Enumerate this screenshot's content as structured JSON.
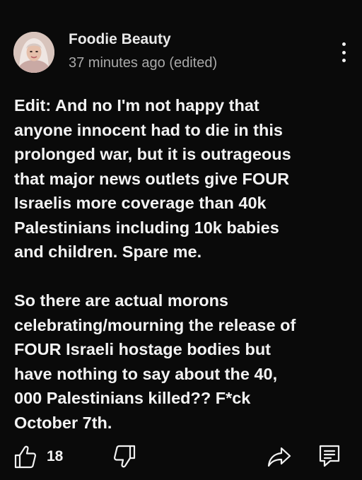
{
  "comment": {
    "author": "Foodie Beauty",
    "timestamp": "37 minutes ago (edited)",
    "paragraphs": [
      "Edit: And no I'm not happy that\nanyone innocent had to die in this\nprolonged war, but it is outrageous\nthat major news outlets give FOUR\nIsraelis more coverage than 40k\nPalestinians including 10k babies\nand children. Spare me.",
      "So there are actual morons\ncelebrating/mourning the release of\nFOUR Israeli hostage bodies but\nhave nothing to say about the 40,\n000 Palestinians killed?? F*ck\nOctober 7th."
    ],
    "like_count": "18"
  },
  "icons": {
    "more": "more-vertical-icon",
    "like": "thumbs-up-icon",
    "dislike": "thumbs-down-icon",
    "share": "share-icon",
    "comments": "comments-icon"
  },
  "colors": {
    "background": "#0a0a0a",
    "text": "#f1f1f1",
    "secondary_text": "#a9a9a9"
  }
}
